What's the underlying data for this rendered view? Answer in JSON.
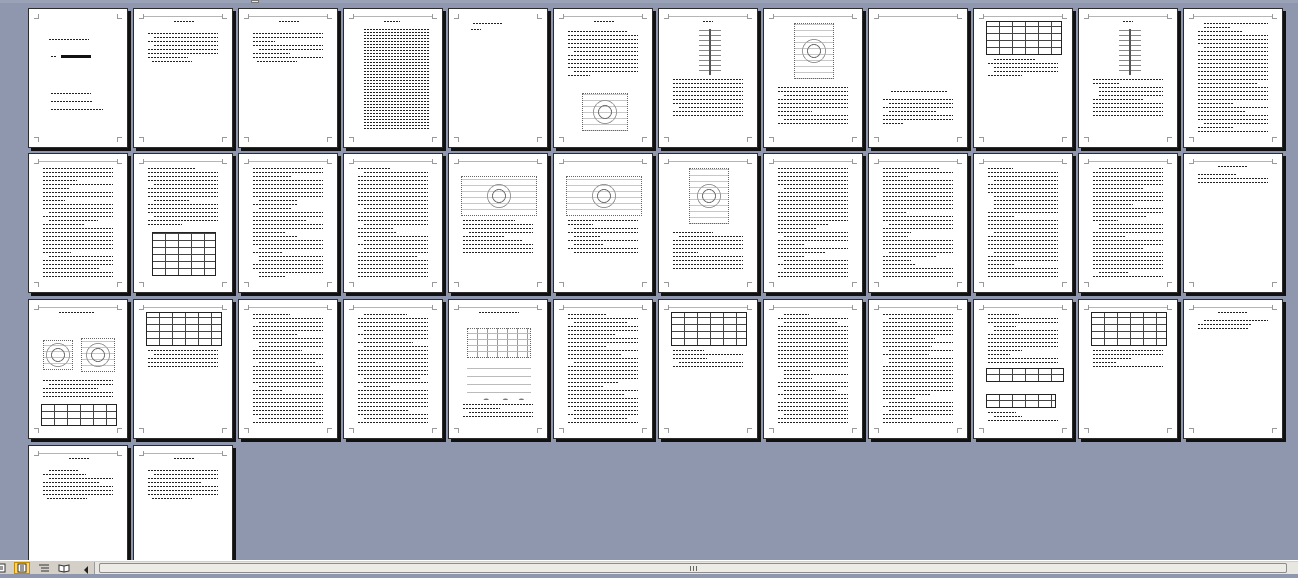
{
  "window": {
    "view_mode": "reading-layout-thumbnails"
  },
  "colors": {
    "workspace_background": "#8e97ad",
    "page": "#ffffff",
    "page_shadow": "#111111",
    "status_bar": "#d4d0c8",
    "active_view_button": "#ffd56b"
  },
  "document": {
    "page_count": 38,
    "rows": [
      {
        "pages": 12
      },
      {
        "pages": 12
      },
      {
        "pages": 12
      },
      {
        "pages": 2
      }
    ]
  },
  "status_bar": {
    "view_buttons": [
      {
        "icon": "normal-view-icon",
        "active": false
      },
      {
        "icon": "print-layout-view-icon",
        "active": true
      },
      {
        "icon": "outline-view-icon",
        "active": false
      },
      {
        "icon": "reading-view-icon",
        "active": false
      }
    ],
    "scroll_left_icon": "arrow-left-icon"
  }
}
